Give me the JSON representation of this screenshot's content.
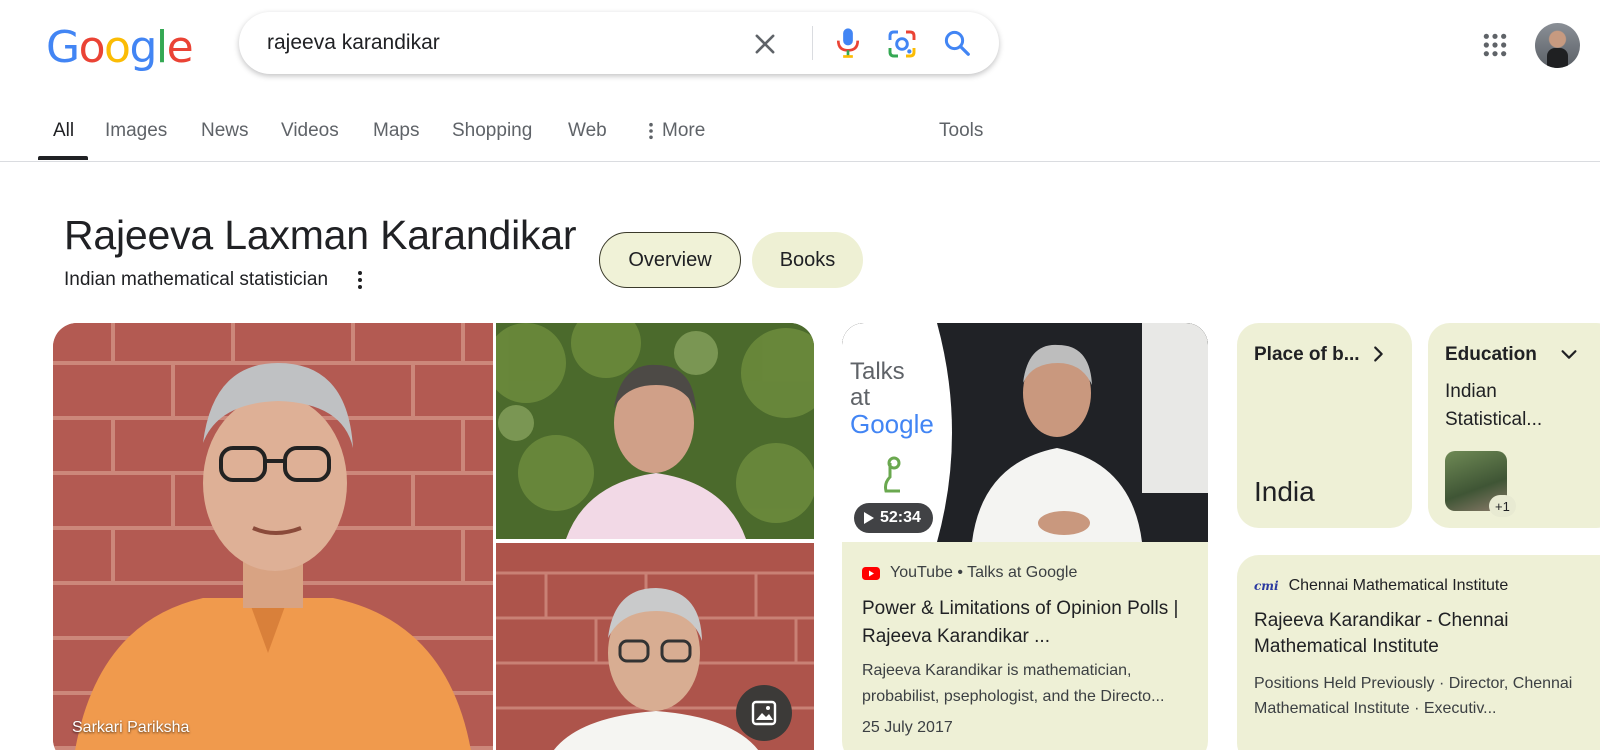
{
  "logo": {
    "letters": [
      "G",
      "o",
      "o",
      "g",
      "l",
      "e"
    ],
    "colors": [
      "#4285F4",
      "#EA4335",
      "#FBBC05",
      "#4285F4",
      "#34A853",
      "#EA4335"
    ]
  },
  "search": {
    "query": "rajeeva karandikar"
  },
  "tabs": [
    {
      "label": "All"
    },
    {
      "label": "Images"
    },
    {
      "label": "News"
    },
    {
      "label": "Videos"
    },
    {
      "label": "Maps"
    },
    {
      "label": "Shopping"
    },
    {
      "label": "Web"
    },
    {
      "label": "More"
    }
  ],
  "tools_label": "Tools",
  "entity": {
    "name": "Rajeeva Laxman Karandikar",
    "description": "Indian mathematical statistician",
    "chips": {
      "overview": "Overview",
      "books": "Books"
    }
  },
  "images": {
    "credit": "Sarkari Pariksha"
  },
  "video": {
    "duration": "52:34",
    "source": "YouTube • Talks at Google",
    "thumb_text": [
      "Talks",
      "at",
      "Google"
    ],
    "title": "Power & Limitations of Opinion Polls | Rajeeva Karandikar ...",
    "description": "Rajeeva Karandikar is mathematician, probabilist, psephologist, and the Directo...",
    "date": "25 July 2017"
  },
  "place_card": {
    "label": "Place of b...",
    "value": "India"
  },
  "education_card": {
    "label": "Education",
    "value": "Indian Statistical...",
    "extra": "+1"
  },
  "cmi_card": {
    "logo_text": "cmi",
    "source": "Chennai Mathematical Institute",
    "title": "Rajeeva Karandikar - Chennai Mathematical Institute",
    "description": "Positions Held Previously · Director, Chennai Mathematical Institute · Executiv..."
  }
}
